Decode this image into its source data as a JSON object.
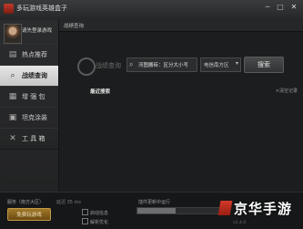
{
  "window": {
    "title": "多玩游戏英雄盒子",
    "controls": [
      "─",
      "□",
      "✕"
    ]
  },
  "sidebar": {
    "login_text": "请先登录游戏",
    "items": [
      {
        "label": "热点推荐",
        "icon": "news-icon",
        "glyph": "▤"
      },
      {
        "label": "战绩查询",
        "icon": "search-icon",
        "glyph": "⌕",
        "active": true
      },
      {
        "label": "增 强 包",
        "icon": "grid-icon",
        "glyph": "▦"
      },
      {
        "label": "坦克涂装",
        "icon": "tank-icon",
        "glyph": "▣"
      },
      {
        "label": "工 具 箱",
        "icon": "tools-icon",
        "glyph": "✕"
      }
    ]
  },
  "main": {
    "title": "战绩查询",
    "search_label": "战绩查询",
    "search_value": "河图搬砖：区分大小写",
    "server_value": "电信南方区",
    "search_button": "搜索",
    "recent_label": "最近搜索",
    "clear_text": "×清空记录"
  },
  "status": {
    "server_text": "服务（南方大区）",
    "extra_text": "延迟 35 ms",
    "free_game_button": "免费玩游戏",
    "option1": "启动信息",
    "option2": "解析优化",
    "update_text": "插件更新中运行",
    "progress_percent": 45,
    "version_text": "v1.4.0"
  },
  "watermark": {
    "text": "京华手游"
  }
}
